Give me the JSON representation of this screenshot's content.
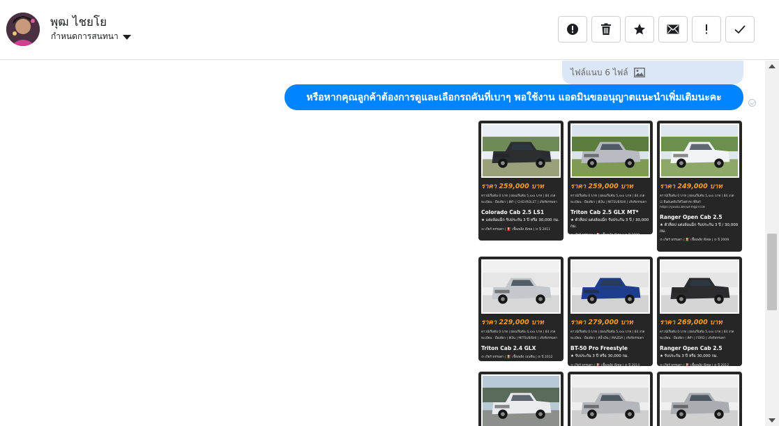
{
  "contact": {
    "name": "พุฒ ไชยโย",
    "subtitle": "กำหนดการสนทนา"
  },
  "toolbar": [
    {
      "name": "spam-button",
      "icon": "alert-circle-icon"
    },
    {
      "name": "delete-button",
      "icon": "trash-icon"
    },
    {
      "name": "star-button",
      "icon": "star-icon"
    },
    {
      "name": "mark-unread-button",
      "icon": "envelope-icon"
    },
    {
      "name": "follow-up-button",
      "icon": "exclamation-icon"
    },
    {
      "name": "done-button",
      "icon": "check-icon"
    }
  ],
  "chat": {
    "attachment_label": "ไฟล์แนบ 6 ไฟล์",
    "message": "หรือหากคุณลูกค้าต้องการดูและเลือกรถคันที่เบาๆ พอใช้งาน แอดมินขออนุญาตแนะนำเพิ่มเติมนะคะ"
  },
  "cards": [
    {
      "price": "ราคา 259,000 บาท",
      "line1": "ดาวน์เริ่มต้น 0 บาท | ผ่อนเริ่มต้น 5,xxx บาท | 84 งวด",
      "line2": "ทะเบียน · มือเดียว | สีดำ | CHEVROLET | เกียร์ธรรมดา",
      "model": "Colorado Cab 2.5 LS1",
      "note": "★ แต่งล้อแม็ก รับประกัน 3 ปี หรือ 30,000 กม.",
      "foot": "⊙ เกียร์ ธรรมดา | ⛽ เชื้อเพลิง ดีเซล | ⊙ ปี 2011"
    },
    {
      "price": "ราคา 259,000 บาท",
      "line1": "ดาวน์เริ่มต้น 0 บาท | ผ่อนเริ่มต้น 5,xxx บาท | 84 งวด",
      "line2": "ทะเบียน · มือเดียว | สีเงิน | MITSUBISHI | เกียร์ธรรมดา",
      "model": "Triton Cab 2.5 GLX MT*",
      "note": "★ ตัวท็อป แต่งล้อแม็ก รับประกัน 3 ปี / 30,000 กม.",
      "foot": "⊙ เกียร์ ธรรมดา | ⛽ เชื้อเพลิง ดีเซล | ⊙ ปี 2009"
    },
    {
      "price": "ราคา 249,000 บาท",
      "line1": "ดาวน์เริ่มต้น 0 บาท | ผ่อนเริ่มต้น 5,xxx บาท | 84 งวด",
      "line2": "☑ ยืนยันคลิปวิดีโอตัวรถ ที่ลิงก์",
      "line3": "https://youtu.be/iZFmgz7cc8",
      "model": "Ranger Open Cab 2.5",
      "note": "★ ตัวท็อป แต่งล้อแม็ก รับประกัน 3 ปี / 30,000 กม.",
      "foot": "⊙ เกียร์ ธรรมดา | ⛽ เชื้อเพลิง ดีเซล | ⊙ ปี 2009"
    },
    {
      "price": "ราคา 229,000 บาท",
      "line1": "ดาวน์เริ่มต้น 0 บาท | ผ่อนเริ่มต้น 4,xxx บาท | 84 งวด",
      "line2": "ทะเบียน · มือเดียว | สีเงิน | MITSUBISHI | เกียร์ธรรมดา",
      "model": "Triton Cab 2.4 GLX",
      "note": "",
      "foot": "⊙ เกียร์ ธรรมดา | ⛽ เชื้อเพลิง เบนซิน | ⊙ ปี 2012"
    },
    {
      "price": "ราคา 279,000 บาท",
      "line1": "ดาวน์เริ่มต้น 0 บาท | ผ่อนเริ่มต้น 5,xxx บาท | 84 งวด",
      "line2": "ทะเบียน · มือเดียว | สีน้ำเงิน | MAZDA | เกียร์ธรรมดา",
      "model": "BT-50 Pro Freestyle",
      "note": "★ รับประกัน 3 ปี หรือ 30,000 กม.",
      "foot": "⊙ เกียร์ ธรรมดา | ⛽ เชื้อเพลิง ดีเซล | ⊙ ปี 2014"
    },
    {
      "price": "ราคา 269,000 บาท",
      "line1": "ดาวน์เริ่มต้น 0 บาท | ผ่อนเริ่มต้น 5,xxx บาท | 84 งวด",
      "line2": "ทะเบียน · มือเดียว | สีดำ | FORD | เกียร์ธรรมดา",
      "model": "Ranger Open Cab 2.5",
      "note": "★ รับประกัน 3 ปี หรือ 30,000 กม.",
      "foot": "⊙ เกียร์ ธรรมดา | ⛽ เชื้อเพลิง ดีเซล | ⊙ ปี 2012"
    },
    {
      "price": "",
      "line1": "",
      "line2": "",
      "model": "",
      "note": "",
      "foot": ""
    },
    {
      "price": "",
      "line1": "",
      "line2": "",
      "model": "",
      "note": "",
      "foot": ""
    },
    {
      "price": "",
      "line1": "",
      "line2": "",
      "model": "",
      "note": "",
      "foot": ""
    }
  ],
  "colors": {
    "accent": "#0084ff",
    "attachment_bubble": "#dbe6f6",
    "card_bg": "#262626",
    "price": "#ff9a2e"
  }
}
